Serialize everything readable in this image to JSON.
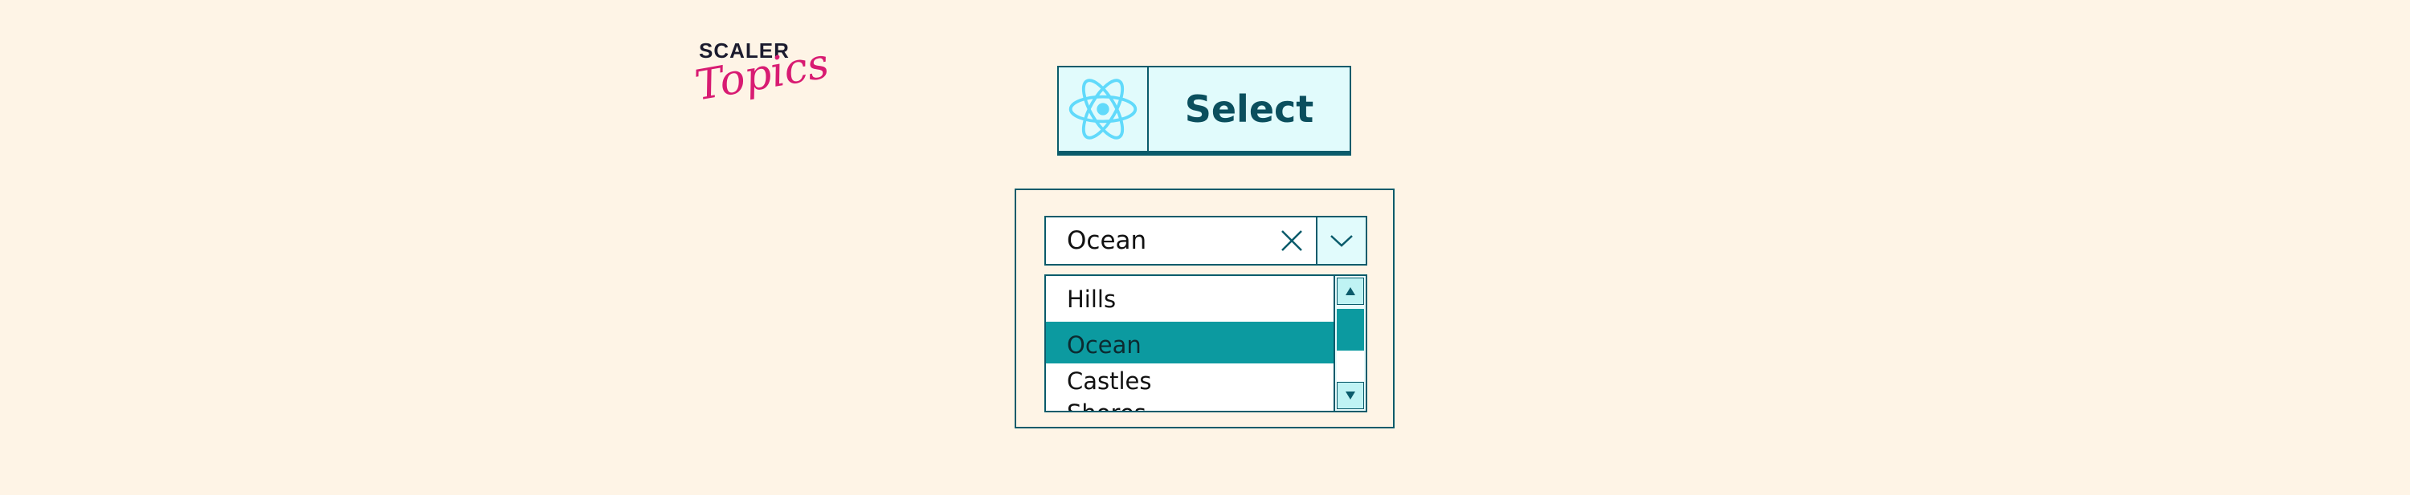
{
  "logo": {
    "line1": "SCALER",
    "line2": "Topics"
  },
  "header": {
    "title": "Select",
    "icon": "react-atom-icon"
  },
  "select": {
    "value": "Ocean",
    "clear_icon": "close-icon",
    "toggle_icon": "chevron-down-icon"
  },
  "listbox": {
    "options": [
      {
        "label": "Hills",
        "selected": false
      },
      {
        "label": "Ocean",
        "selected": true
      },
      {
        "label": "Castles",
        "selected": false
      },
      {
        "label": "Shores",
        "selected": false
      }
    ],
    "scroll_up_icon": "triangle-up-icon",
    "scroll_down_icon": "triangle-down-icon"
  },
  "colors": {
    "background": "#fef4e6",
    "border": "#0a5b6b",
    "accent": "#0c9aa0",
    "badge_bg": "#e1fbfc",
    "logo_pink": "#d81b72",
    "react_blue": "#61dafb"
  }
}
